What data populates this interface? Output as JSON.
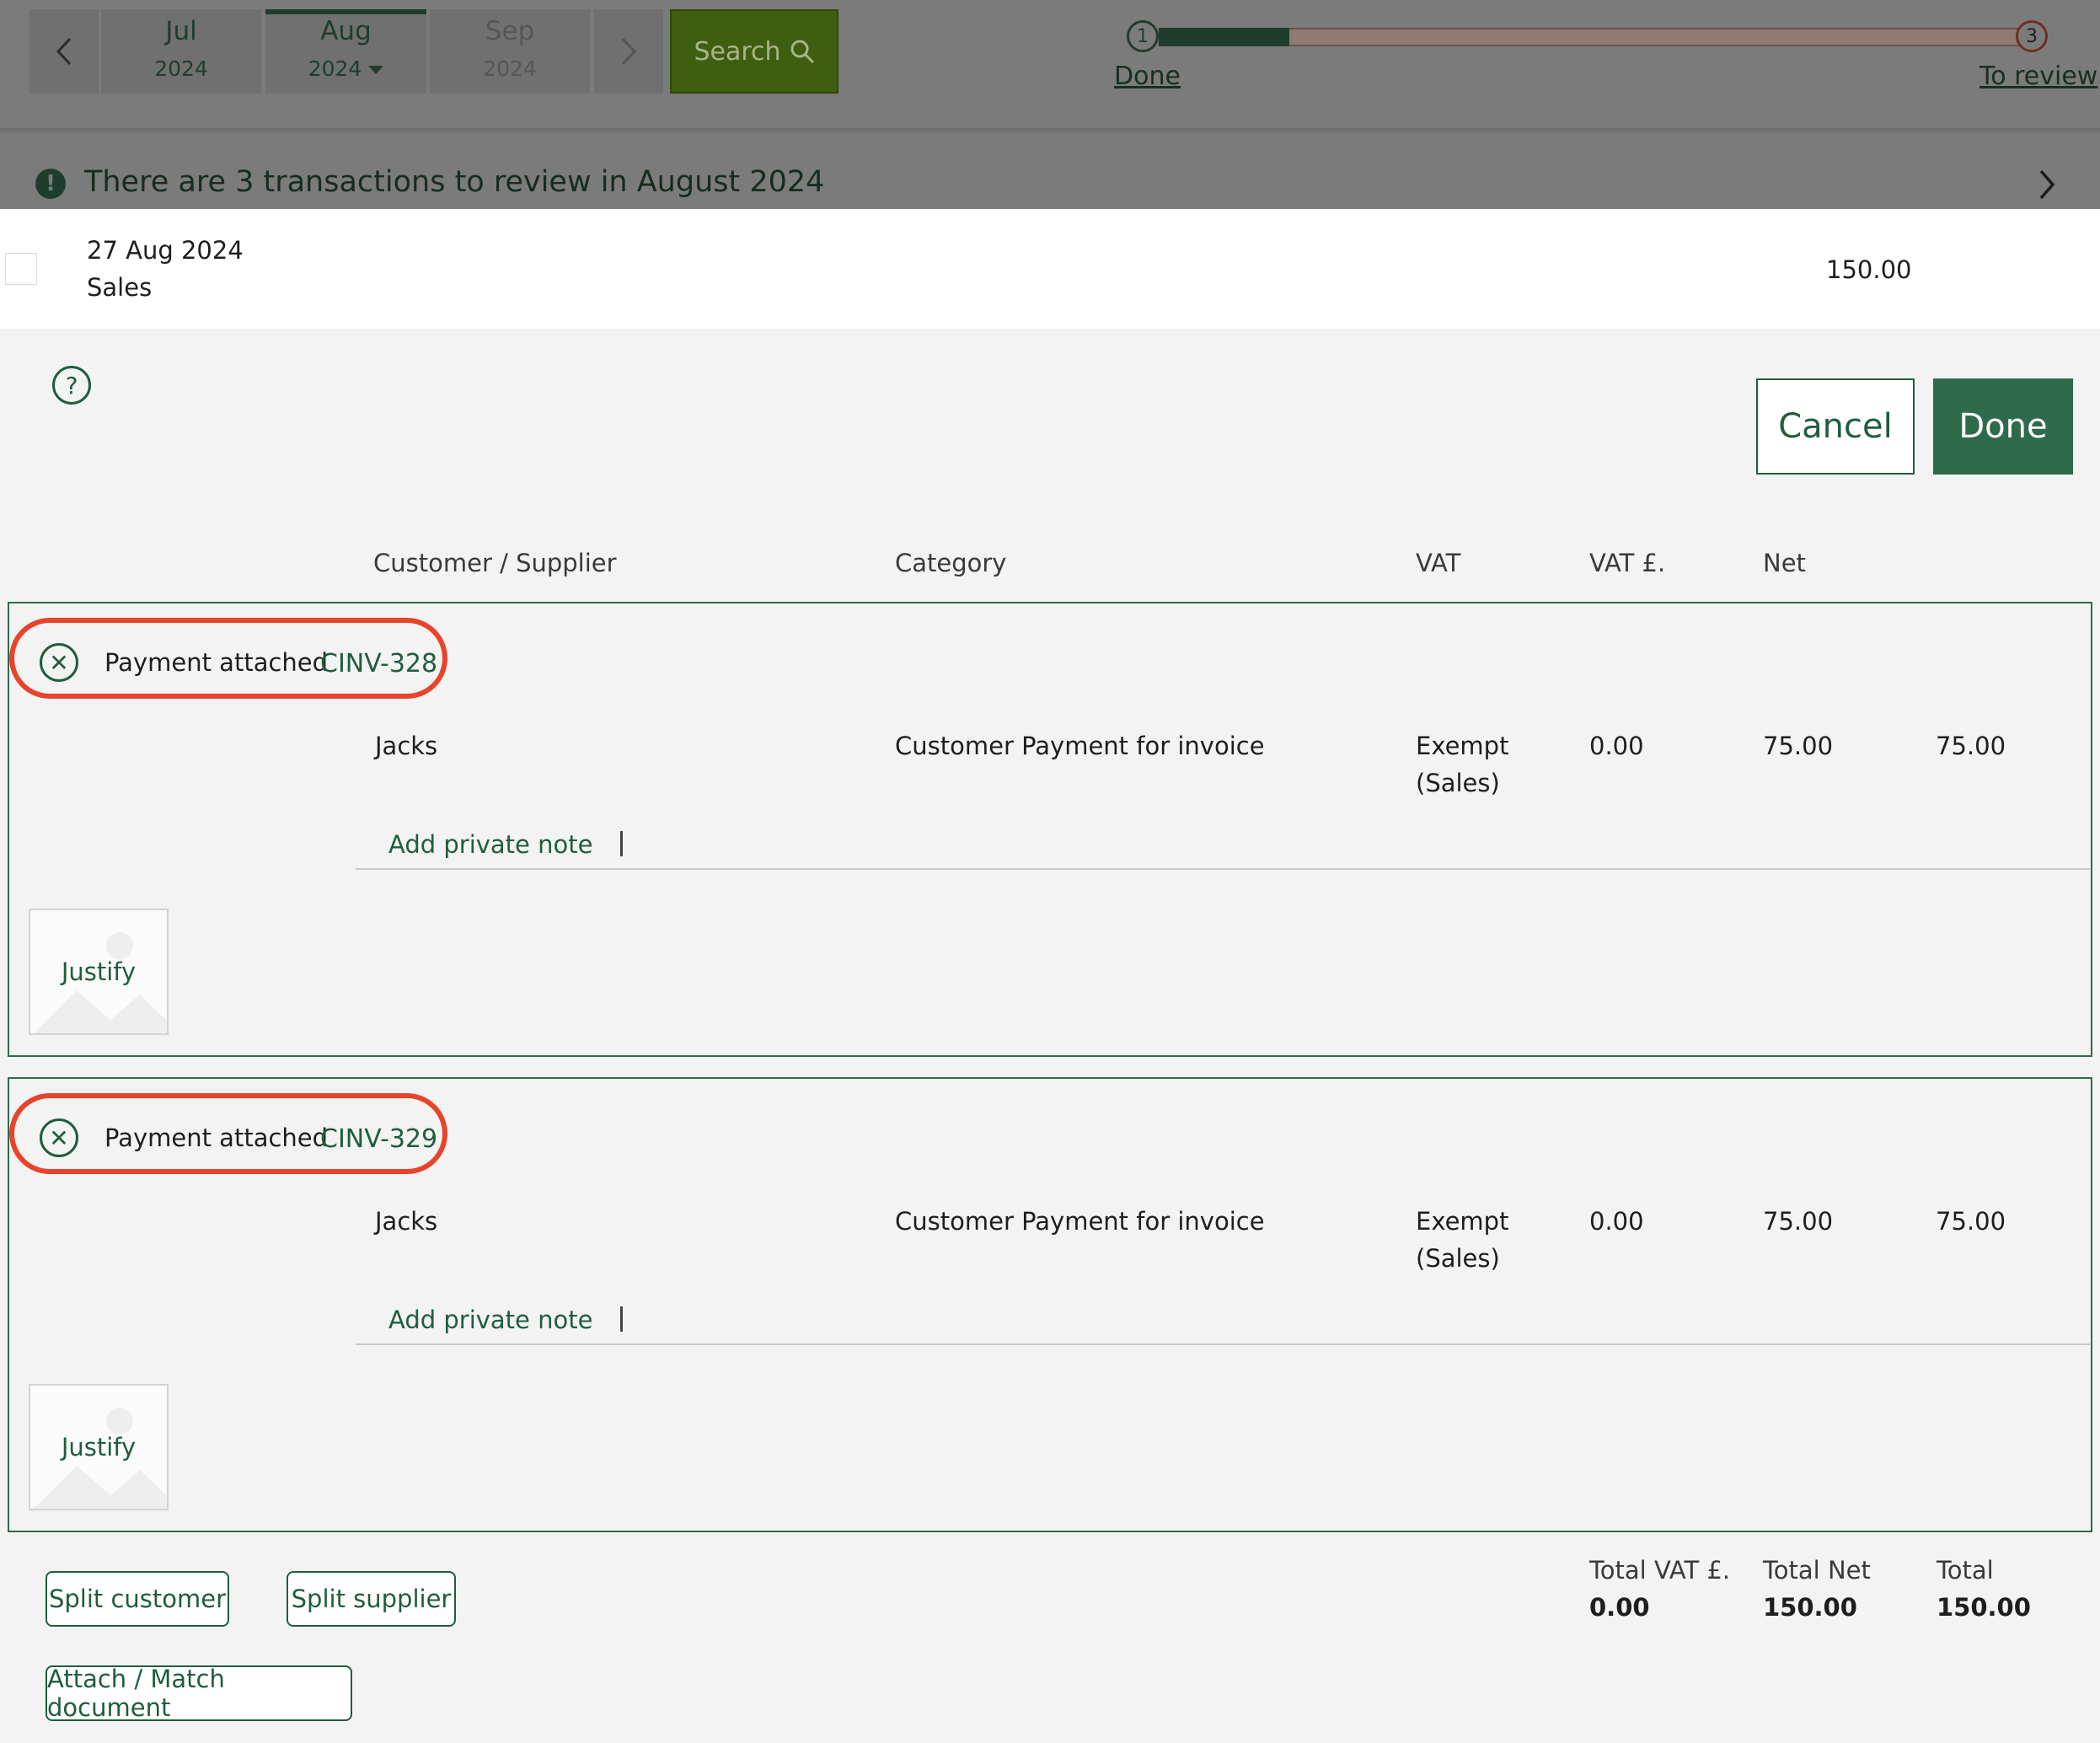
{
  "months": [
    {
      "month": "Jul",
      "year": "2024"
    },
    {
      "month": "Aug",
      "year": "2024"
    },
    {
      "month": "Sep",
      "year": "2024"
    }
  ],
  "search": {
    "label": "Search"
  },
  "progress": {
    "start_step": "1",
    "end_step": "3",
    "done_label": "Done",
    "review_label": "To review",
    "fraction_done": 0.15
  },
  "banner": {
    "text": "There are 3 transactions to review in August 2024"
  },
  "transaction": {
    "date": "27 Aug 2024",
    "type": "Sales",
    "amount": "150.00"
  },
  "actions": {
    "cancel_label": "Cancel",
    "done_label": "Done"
  },
  "columns": {
    "customer": "Customer / Supplier",
    "category": "Category",
    "vat": "VAT",
    "vat_amount": "VAT £.",
    "net": "Net"
  },
  "splits": [
    {
      "payment_label": "Payment attached",
      "invoice": "CINV-328",
      "customer": "Jacks",
      "category": "Customer Payment for invoice",
      "vat_line1": "Exempt",
      "vat_line2": "(Sales)",
      "vat_amount": "0.00",
      "net": "75.00",
      "total": "75.00",
      "note_label": "Add private note",
      "justify_label": "Justify"
    },
    {
      "payment_label": "Payment attached",
      "invoice": "CINV-329",
      "customer": "Jacks",
      "category": "Customer Payment for invoice",
      "vat_line1": "Exempt",
      "vat_line2": "(Sales)",
      "vat_amount": "0.00",
      "net": "75.00",
      "total": "75.00",
      "note_label": "Add private note",
      "justify_label": "Justify"
    }
  ],
  "footer": {
    "split_customer": "Split customer",
    "split_supplier": "Split supplier",
    "attach_match": "Attach / Match document",
    "total_vat_label": "Total VAT £.",
    "total_vat": "0.00",
    "total_net_label": "Total Net",
    "total_net": "150.00",
    "total_label": "Total",
    "total": "150.00"
  },
  "colors": {
    "brand": "#1f5d3d",
    "highlight": "#e8432b",
    "dim_overlay": "#7b7b7b"
  }
}
